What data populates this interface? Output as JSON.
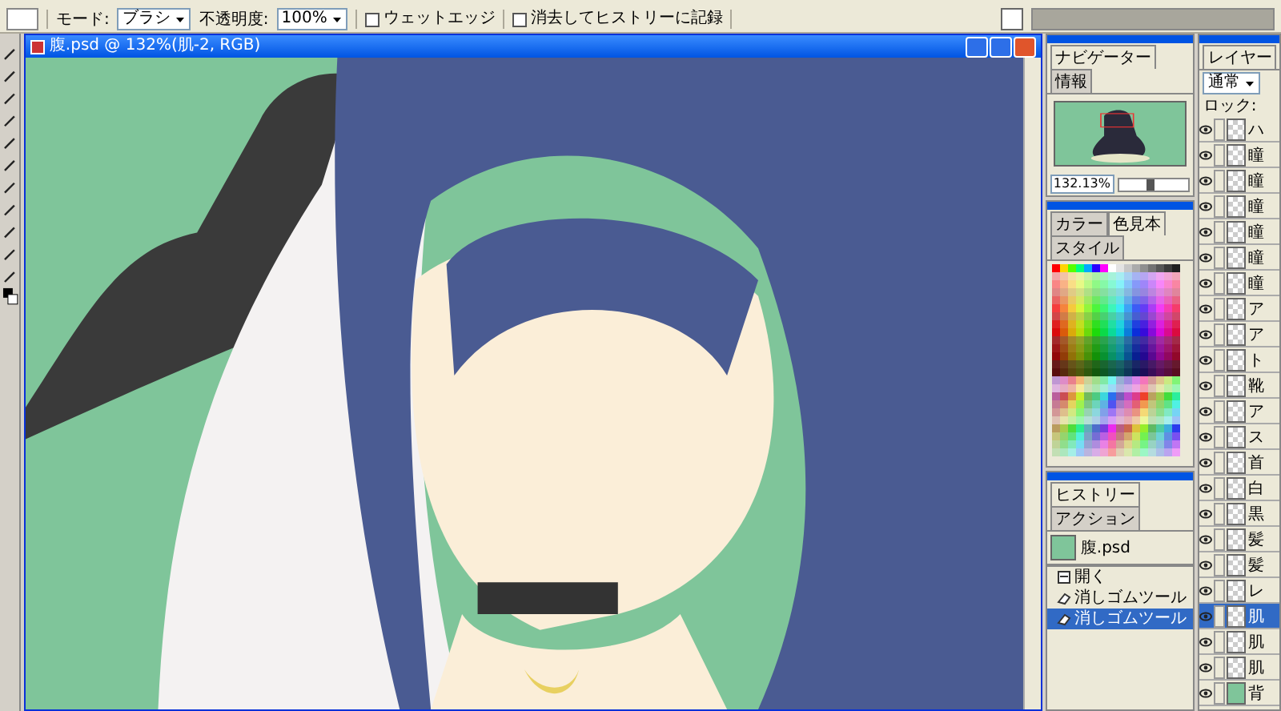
{
  "options_bar": {
    "mode_label": "モード:",
    "mode": "ブラシ",
    "opacity_label": "不透明度:",
    "opacity": "100%",
    "checkboxes": [
      {
        "label": "ウェットエッジ",
        "checked": false
      },
      {
        "label": "消去してヒストリーに記録",
        "checked": false
      }
    ]
  },
  "document": {
    "title": "腹.psd @ 132%(肌-2, RGB)"
  },
  "navigator": {
    "tabs": [
      {
        "label": "ナビゲーター",
        "selected": true
      },
      {
        "label": "情報",
        "selected": false
      }
    ],
    "zoom": "132.13%",
    "zoom_slider": {
      "level": 0.45
    }
  },
  "color_panel": {
    "tabs": [
      {
        "label": "カラー",
        "selected": false
      },
      {
        "label": "色見本",
        "selected": true
      },
      {
        "label": "スタイル",
        "selected": false
      }
    ]
  },
  "history": {
    "tabs": [
      {
        "label": "ヒストリー",
        "selected": true
      },
      {
        "label": "アクション",
        "selected": false
      }
    ],
    "snapshot": "腹.psd",
    "items": [
      {
        "kind": "open",
        "label": "開く",
        "selected": false
      },
      {
        "kind": "eraser",
        "label": "消しゴムツール",
        "selected": false
      },
      {
        "kind": "eraser",
        "label": "消しゴムツール",
        "selected": true
      }
    ]
  },
  "layers": {
    "tabs": [
      {
        "label": "レイヤー",
        "selected": true
      }
    ],
    "blend_mode": "通常",
    "lock_label": "ロック:",
    "items": [
      {
        "name": "ハ",
        "kind": "layer",
        "selected": false
      },
      {
        "name": "瞳",
        "kind": "layer",
        "selected": false
      },
      {
        "name": "瞳",
        "kind": "layer",
        "selected": false
      },
      {
        "name": "瞳",
        "kind": "layer",
        "selected": false
      },
      {
        "name": "瞳",
        "kind": "layer",
        "selected": false
      },
      {
        "name": "瞳",
        "kind": "layer",
        "selected": false
      },
      {
        "name": "瞳",
        "kind": "layer",
        "selected": false
      },
      {
        "name": "ア",
        "kind": "layer",
        "selected": false
      },
      {
        "name": "ア",
        "kind": "layer",
        "selected": false
      },
      {
        "name": "ト",
        "kind": "layer",
        "selected": false
      },
      {
        "name": "靴",
        "kind": "layer",
        "selected": false
      },
      {
        "name": "ア",
        "kind": "layer",
        "selected": false
      },
      {
        "name": "ス",
        "kind": "layer",
        "selected": false
      },
      {
        "name": "首",
        "kind": "layer",
        "selected": false
      },
      {
        "name": "白",
        "kind": "layer",
        "selected": false
      },
      {
        "name": "黒",
        "kind": "layer",
        "selected": false
      },
      {
        "name": "髪",
        "kind": "layer",
        "selected": false
      },
      {
        "name": "髪",
        "kind": "layer",
        "selected": false
      },
      {
        "name": "レ",
        "kind": "layer",
        "selected": false
      },
      {
        "name": "肌",
        "kind": "layer",
        "selected": true
      },
      {
        "name": "肌",
        "kind": "layer",
        "selected": false
      },
      {
        "name": "肌",
        "kind": "layer",
        "selected": false
      },
      {
        "name": "背",
        "kind": "background",
        "selected": false
      }
    ]
  }
}
